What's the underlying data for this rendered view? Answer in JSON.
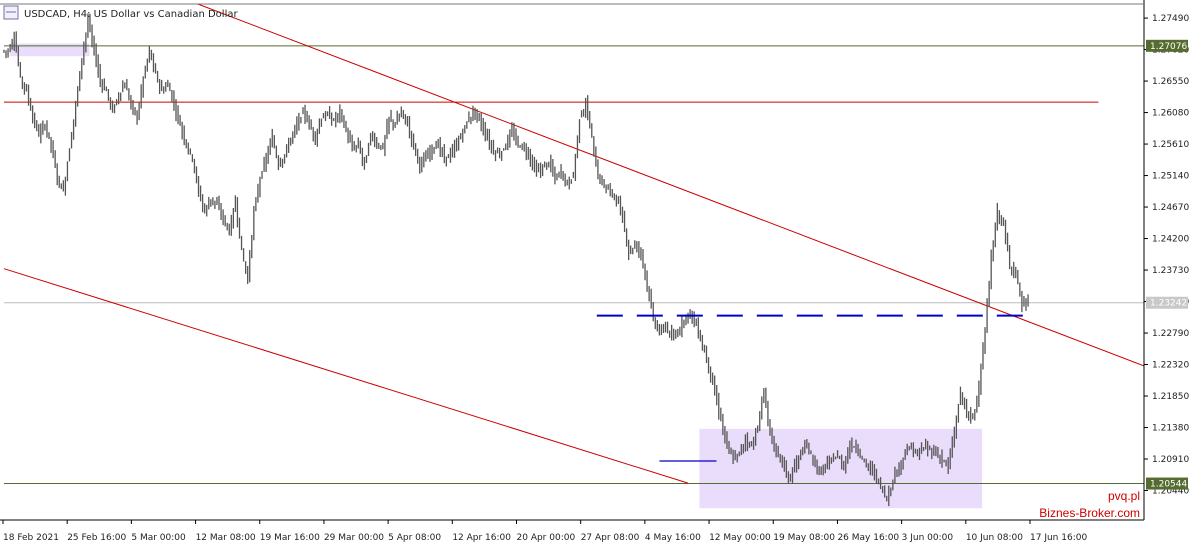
{
  "header": {
    "title": "USDCAD, H4:  US Dollar vs Canadian Dollar",
    "icon": "chart-window-icon"
  },
  "watermark": {
    "line1": "pvq.pl",
    "line2": "Biznes-Broker.com"
  },
  "colors": {
    "candle": "#555555",
    "trendline": "#cc0000",
    "support": "#556b2f",
    "zone": "#eadcfb",
    "blue_dash": "#0000cc",
    "price_line": "#bbbbbb",
    "axis": "#000000"
  },
  "chart_data": {
    "type": "line",
    "symbol": "USDCAD",
    "timeframe": "H4",
    "ylim": [
      1.2,
      1.277
    ],
    "y_ticks": [
      "1.27490",
      "1.27020",
      "1.26550",
      "1.26080",
      "1.25610",
      "1.25140",
      "1.24670",
      "1.24200",
      "1.23730",
      "1.23260",
      "1.22790",
      "1.22320",
      "1.21850",
      "1.21380",
      "1.20910",
      "1.20440"
    ],
    "x_ticks": [
      "18 Feb 2021",
      "25 Feb 16:00",
      "5 Mar 00:00",
      "12 Mar 08:00",
      "19 Mar 16:00",
      "29 Mar 00:00",
      "5 Apr 08:00",
      "12 Apr 16:00",
      "20 Apr 00:00",
      "27 Apr 08:00",
      "4 May 16:00",
      "12 May 00:00",
      "19 May 08:00",
      "26 May 16:00",
      "3 Jun 00:00",
      "10 Jun 08:00",
      "17 Jun 16:00"
    ],
    "price_labels": [
      {
        "label": "1.27076",
        "value": 1.27076,
        "kind": "support"
      },
      {
        "label": "1.23242",
        "value": 1.23242,
        "kind": "current"
      },
      {
        "label": "1.20544",
        "value": 1.20544,
        "kind": "support"
      }
    ],
    "series": [
      {
        "values": [
          1.27,
          1.272,
          1.266,
          1.264,
          1.26,
          1.2575,
          1.259,
          1.256,
          1.251,
          1.249,
          1.2555,
          1.262,
          1.269,
          1.2745,
          1.27,
          1.2655,
          1.264,
          1.261,
          1.2635,
          1.265,
          1.262,
          1.26,
          1.266,
          1.27,
          1.2665,
          1.264,
          1.265,
          1.262,
          1.259,
          1.256,
          1.254,
          1.249,
          1.246,
          1.248,
          1.247,
          1.245,
          1.243,
          1.2475,
          1.24,
          1.236,
          1.246,
          1.251,
          1.254,
          1.257,
          1.253,
          1.2545,
          1.257,
          1.259,
          1.261,
          1.259,
          1.257,
          1.26,
          1.2605,
          1.2595,
          1.261,
          1.258,
          1.2555,
          1.256,
          1.253,
          1.2575,
          1.256,
          1.2555,
          1.26,
          1.259,
          1.261,
          1.259,
          1.256,
          1.253,
          1.254,
          1.2555,
          1.256,
          1.254,
          1.2545,
          1.256,
          1.258,
          1.26,
          1.261,
          1.259,
          1.257,
          1.255,
          1.2545,
          1.256,
          1.258,
          1.256,
          1.2555,
          1.254,
          1.252,
          1.2525,
          1.2535,
          1.251,
          1.252,
          1.25,
          1.2515,
          1.26,
          1.262,
          1.257,
          1.251,
          1.25,
          1.249,
          1.248,
          1.245,
          1.24,
          1.241,
          1.24,
          1.235,
          1.23,
          1.228,
          1.229,
          1.227,
          1.228,
          1.23,
          1.231,
          1.229,
          1.226,
          1.223,
          1.219,
          1.215,
          1.211,
          1.209,
          1.21,
          1.212,
          1.211,
          1.214,
          1.219,
          1.213,
          1.21,
          1.209,
          1.206,
          1.208,
          1.21,
          1.211,
          1.209,
          1.207,
          1.208,
          1.209,
          1.2095,
          1.208,
          1.211,
          1.211,
          1.209,
          1.208,
          1.207,
          1.205,
          1.203,
          1.206,
          1.208,
          1.21,
          1.211,
          1.2095,
          1.211,
          1.2105,
          1.21,
          1.209,
          1.208,
          1.213,
          1.219,
          1.216,
          1.215,
          1.22,
          1.228,
          1.239,
          1.246,
          1.244,
          1.238,
          1.237,
          1.232,
          1.2325
        ]
      }
    ],
    "annotations": {
      "trendlines": [
        {
          "from": [
            0.17,
            1.277
          ],
          "to": [
            1.0,
            1.223
          ]
        },
        {
          "from": [
            0.0,
            1.2375
          ],
          "to": [
            0.6,
            1.2055
          ]
        }
      ],
      "horizontal_lines": [
        {
          "value": 1.27076,
          "color": "support"
        },
        {
          "value": 1.26235,
          "color": "trendline",
          "to": 0.96
        },
        {
          "value": 1.20544,
          "color": "support"
        },
        {
          "value": 1.23242,
          "color": "price_line"
        }
      ],
      "zones": [
        {
          "x": [
            0.005,
            0.075
          ],
          "y": [
            1.2692,
            1.2711
          ]
        },
        {
          "x": [
            0.61,
            0.858
          ],
          "y": [
            1.20175,
            1.2136
          ]
        }
      ],
      "blue_dash": {
        "value": 1.2305,
        "x": [
          0.52,
          0.9
        ]
      },
      "small_support": {
        "value": 1.2088,
        "x": [
          0.575,
          0.625
        ]
      }
    },
    "grid": false,
    "legend": "none"
  }
}
